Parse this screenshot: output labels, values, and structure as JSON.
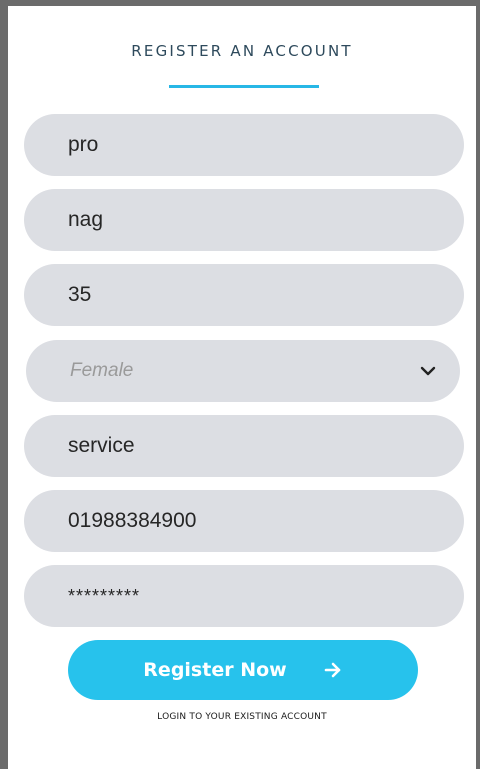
{
  "header": {
    "title": "REGISTER AN ACCOUNT"
  },
  "form": {
    "first_name": "pro",
    "last_name": "nag",
    "age": "35",
    "gender": {
      "selected": "Female",
      "icon": "chevron-down-icon"
    },
    "occupation": "service",
    "phone": "01988384900",
    "password": "*********"
  },
  "actions": {
    "register_label": "Register Now",
    "register_icon": "arrow-right-icon",
    "login_link": "LOGIN TO YOUR EXISTING ACCOUNT"
  },
  "colors": {
    "accent": "#27c2ec",
    "underline": "#27b7e6",
    "field_background": "#dcdee3",
    "title_text": "#2e4a5c"
  }
}
